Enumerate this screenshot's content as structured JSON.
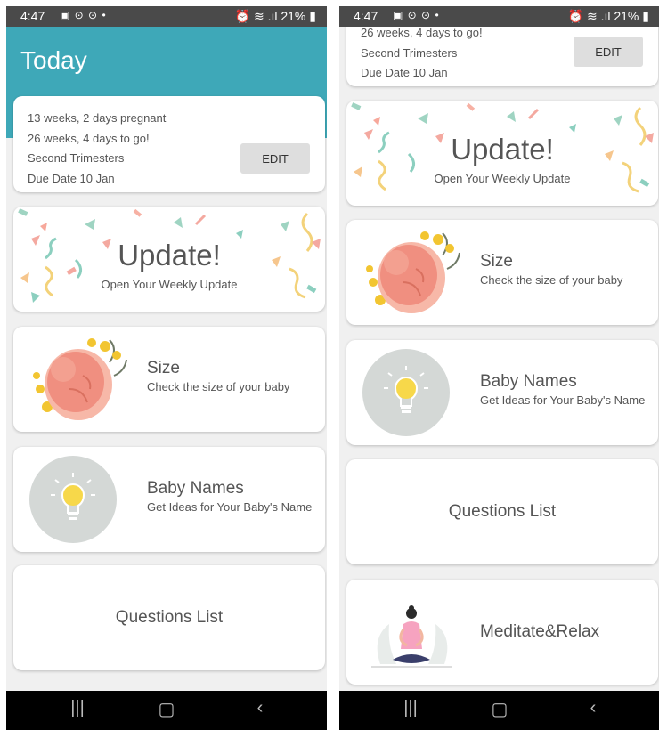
{
  "status_bar": {
    "time": "4:47",
    "left_icons": "▣ ⊙ ⊙ •",
    "right_icons": "⏰ ≋ .ıl",
    "battery": "21%"
  },
  "header": {
    "title": "Today"
  },
  "pregnancy_info": {
    "weeks_pregnant": "13 weeks, 2 days pregnant",
    "weeks_to_go": "26 weeks, 4 days to go!",
    "trimester": "Second Trimesters",
    "due_date": "Due Date 10 Jan",
    "edit_label": "EDIT"
  },
  "update_card": {
    "title": "Update!",
    "subtitle": "Open Your Weekly Update"
  },
  "size_card": {
    "title": "Size",
    "subtitle": "Check the size of your baby"
  },
  "names_card": {
    "title": "Baby Names",
    "subtitle": "Get Ideas for Your Baby's Name"
  },
  "questions_card": {
    "title": "Questions List"
  },
  "meditate_card": {
    "title": "Meditate&Relax"
  },
  "nav_bar": {
    "recents_icon": "recents-icon",
    "home_icon": "home-icon",
    "back_icon": "back-icon"
  },
  "colors": {
    "header": "#3ea8b8",
    "status_bar": "#4a4a4a",
    "nav_bar": "#000000",
    "card": "#ffffff",
    "background": "#f0f0f0"
  }
}
